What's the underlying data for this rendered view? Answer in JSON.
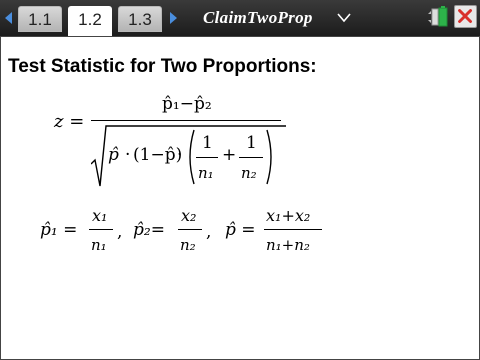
{
  "tabs": [
    {
      "label": "1.1",
      "active": false
    },
    {
      "label": "1.2",
      "active": true
    },
    {
      "label": "1.3",
      "active": false
    }
  ],
  "document_title": "ClaimTwoProp",
  "heading": "Test Statistic for Two Proportions:",
  "formula1": {
    "lhs": "z =",
    "numerator": "p̂₁−p̂₂",
    "p_hat": "p̂",
    "dot": "·",
    "one_minus": "(1−p̂)",
    "one": "1",
    "plus": "+",
    "n1": "n₁",
    "n2": "n₂"
  },
  "formula2": {
    "p1_hat": "p̂₁ =",
    "x1": "x₁",
    "n1": "n₁",
    "sep1": ",",
    "p2_hat": "p̂₂=",
    "x2": "x₂",
    "n2": "n₂",
    "sep2": ",",
    "p_hat": "p̂ =",
    "x_sum": "x₁+x₂",
    "n_sum": "n₁+n₂"
  },
  "colors": {
    "accent": "#4a8ede",
    "battery": "#2db34a",
    "close": "#d9302c"
  },
  "icons": {
    "battery": "battery-icon",
    "close": "close-icon"
  }
}
